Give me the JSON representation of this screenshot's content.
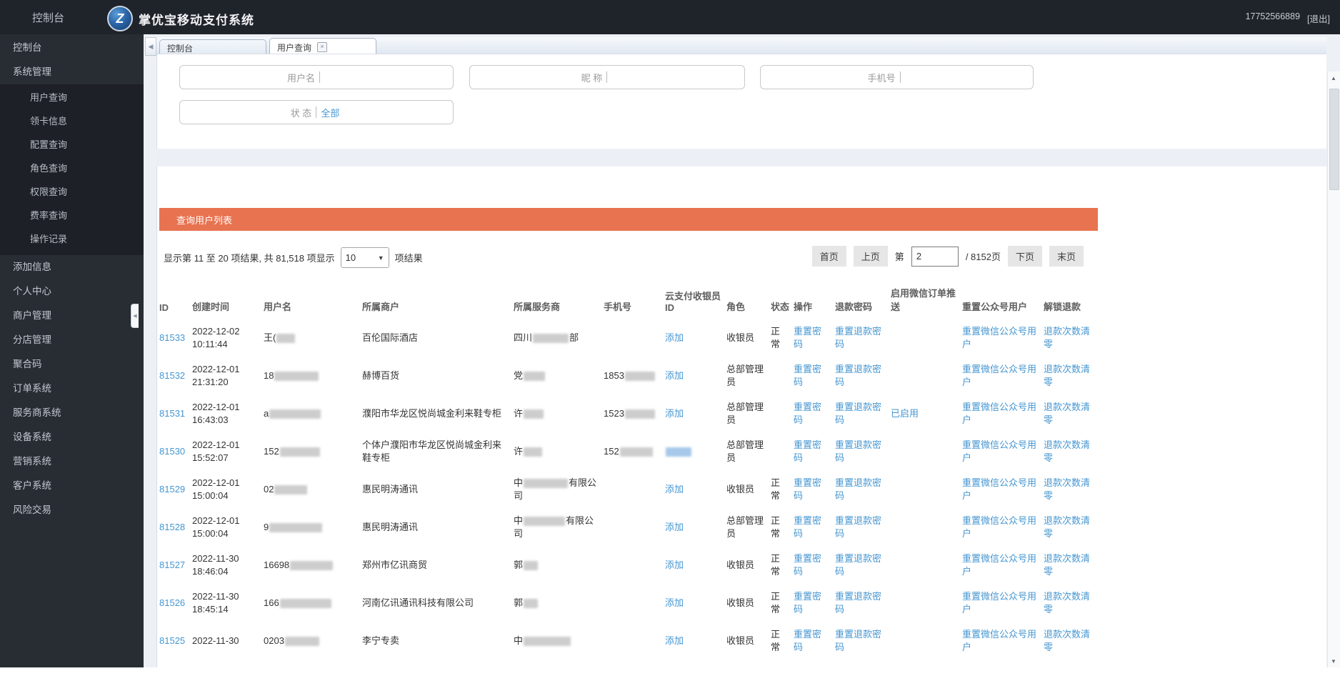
{
  "topbar": {
    "console": "控制台",
    "brand": "掌优宝移动支付系统",
    "logo_glyph": "Z",
    "phone": "17752566889",
    "logout": "[退出]"
  },
  "sidebar": {
    "top_items": [
      "控制台",
      "系统管理"
    ],
    "submenu": [
      "用户查询",
      "领卡信息",
      "配置查询",
      "角色查询",
      "权限查询",
      "费率查询",
      "操作记录"
    ],
    "bottom_items": [
      "添加信息",
      "个人中心",
      "商户管理",
      "分店管理",
      "聚合码",
      "订单系统",
      "服务商系统",
      "设备系统",
      "营销系统",
      "客户系统",
      "风险交易"
    ]
  },
  "tabs": [
    {
      "label": "控制台",
      "closable": false,
      "active": false
    },
    {
      "label": "用户查询",
      "closable": true,
      "active": true
    }
  ],
  "search": {
    "fields": [
      {
        "label": "用户名"
      },
      {
        "label": "昵 称"
      },
      {
        "label": "手机号"
      }
    ],
    "status_label": "状 态",
    "status_value": "全部"
  },
  "panel": {
    "title": "查询用户列表"
  },
  "stats": {
    "prefix": "显示第 11 至 20 项结果, 共 81,518 项显示",
    "page_size": "10",
    "suffix": "项结果"
  },
  "pagination": {
    "first": "首页",
    "prev": "上页",
    "page_label": "第",
    "page_value": "2",
    "total": "/ 8152页",
    "next": "下页",
    "last": "末页"
  },
  "table": {
    "headers": [
      "ID",
      "创建时间",
      "用户名",
      "所属商户",
      "所属服务商",
      "手机号",
      "云支付收银员ID",
      "角色",
      "状态",
      "操作",
      "退款密码",
      "启用微信订单推送",
      "重置公众号用户",
      "解锁退款"
    ],
    "actions": {
      "add": "添加",
      "enabled": "已启用",
      "reset_pwd": "重置密码",
      "reset_refund_pwd": "重置退款密码",
      "reset_wechat": "重置微信公众号用户",
      "clear_refund": "退款次数清零"
    },
    "rows": [
      {
        "id": "81533",
        "date": "2022-12-02",
        "time": "10:11:44",
        "user": [
          {
            "t": "王("
          },
          {
            "r": 26
          }
        ],
        "merchant": "百伦国际酒店",
        "provider": [
          {
            "t": "四川"
          },
          {
            "r": 50
          },
          {
            "t": "部"
          }
        ],
        "phone": [],
        "cloud": "add",
        "role": "收银员",
        "status": "正常",
        "push": ""
      },
      {
        "id": "81532",
        "date": "2022-12-01",
        "time": "21:31:20",
        "user": [
          {
            "t": "18"
          },
          {
            "r": 62
          }
        ],
        "merchant": "赫博百货",
        "provider": [
          {
            "t": "党"
          },
          {
            "r": 30
          }
        ],
        "phone": [
          {
            "t": "1853"
          },
          {
            "r": 42
          }
        ],
        "cloud": "add",
        "role": "总部管理员",
        "status": "",
        "push": ""
      },
      {
        "id": "81531",
        "date": "2022-12-01",
        "time": "16:43:03",
        "user": [
          {
            "t": "a"
          },
          {
            "r": 72
          }
        ],
        "merchant": "濮阳市华龙区悦尚城金利来鞋专柜",
        "provider": [
          {
            "t": "许"
          },
          {
            "r": 28
          }
        ],
        "phone": [
          {
            "t": "1523"
          },
          {
            "r": 42
          }
        ],
        "cloud": "add",
        "role": "总部管理员",
        "status": "",
        "push": "已启用"
      },
      {
        "id": "81530",
        "date": "2022-12-01",
        "time": "15:52:07",
        "user": [
          {
            "t": "152"
          },
          {
            "r": 56
          }
        ],
        "merchant": "个体户濮阳市华龙区悦尚城金利来鞋专柜",
        "provider": [
          {
            "t": "许"
          },
          {
            "r": 26
          }
        ],
        "phone": [
          {
            "t": "152"
          },
          {
            "r": 46
          }
        ],
        "cloud": "redact",
        "role": "总部管理员",
        "status": "",
        "push": ""
      },
      {
        "id": "81529",
        "date": "2022-12-01",
        "time": "15:00:04",
        "user": [
          {
            "t": "02"
          },
          {
            "r": 46
          }
        ],
        "merchant": "惠民明涛通讯",
        "provider": [
          {
            "t": "中"
          },
          {
            "r": 62
          },
          {
            "t": "有限公司"
          }
        ],
        "phone": [],
        "cloud": "add",
        "role": "收银员",
        "status": "正常",
        "push": ""
      },
      {
        "id": "81528",
        "date": "2022-12-01",
        "time": "15:00:04",
        "user": [
          {
            "t": "9"
          },
          {
            "r": 74
          }
        ],
        "merchant": "惠民明涛通讯",
        "provider": [
          {
            "t": "中"
          },
          {
            "r": 58
          },
          {
            "t": "有限公司"
          }
        ],
        "phone": [],
        "cloud": "add",
        "role": "总部管理员",
        "status": "正常",
        "push": ""
      },
      {
        "id": "81527",
        "date": "2022-11-30",
        "time": "18:46:04",
        "user": [
          {
            "t": "16698"
          },
          {
            "r": 60
          }
        ],
        "merchant": "郑州市亿讯商贸",
        "provider": [
          {
            "t": "郭"
          },
          {
            "r": 20
          }
        ],
        "phone": [],
        "cloud": "add",
        "role": "收银员",
        "status": "正常",
        "push": ""
      },
      {
        "id": "81526",
        "date": "2022-11-30",
        "time": "18:45:14",
        "user": [
          {
            "t": "166"
          },
          {
            "r": 72
          }
        ],
        "merchant": "河南亿讯通讯科技有限公司",
        "provider": [
          {
            "t": "郭"
          },
          {
            "r": 20
          }
        ],
        "phone": [],
        "cloud": "add",
        "role": "收银员",
        "status": "正常",
        "push": ""
      },
      {
        "id": "81525",
        "date": "2022-11-30",
        "time": "",
        "user": [
          {
            "t": "0203"
          },
          {
            "r": 48
          }
        ],
        "merchant": "李宁专卖",
        "provider": [
          {
            "t": "中"
          },
          {
            "r": 66
          }
        ],
        "phone": [],
        "cloud": "add",
        "role": "收银员",
        "status": "正常",
        "push": ""
      }
    ]
  }
}
